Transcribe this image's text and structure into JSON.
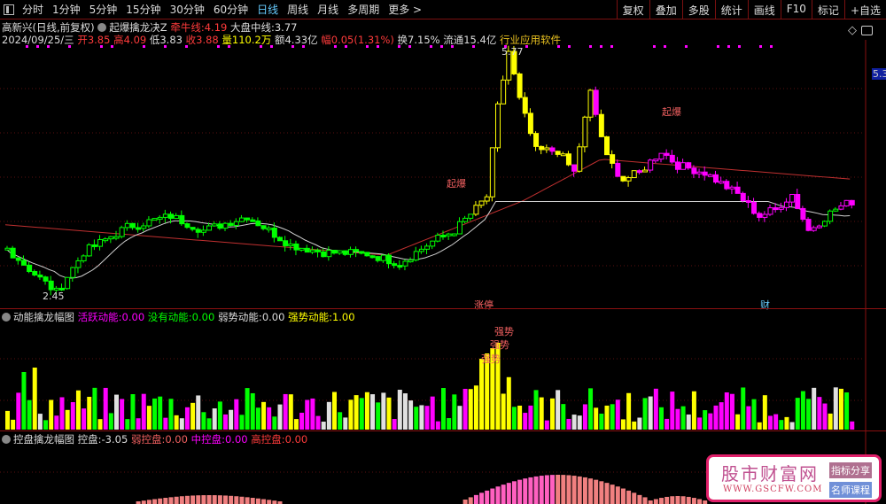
{
  "toolbar": {
    "tabs": [
      "分时",
      "1分钟",
      "5分钟",
      "15分钟",
      "30分钟",
      "60分钟",
      "日线",
      "周线",
      "月线",
      "多周期",
      "更多 >"
    ],
    "active": "日线",
    "right_buttons": [
      "复权",
      "叠加",
      "多股",
      "统计",
      "画线",
      "F10",
      "标记",
      "+自选"
    ]
  },
  "header": {
    "stock": "高新兴(日线,前复权)",
    "indicator": "起爆擒龙决Z",
    "bull_label": "牵牛线:",
    "bull_value": "4.19",
    "market_label": "大盘中线:",
    "market_value": "3.77",
    "date": "2024/09/25/三",
    "open_label": "开",
    "open": "3.85",
    "high_label": "高",
    "high": "4.09",
    "low_label": "低",
    "low": "3.83",
    "close_label": "收",
    "close": "3.88",
    "vol_label": "量",
    "vol": "110.2万",
    "amt_label": "额",
    "amt": "4.33亿",
    "chg_label": "幅",
    "chg": "0.05(1.31%)",
    "turn_label": "换",
    "turn": "7.15%",
    "float_label": "流通",
    "float": "15.4亿",
    "industry": "行业应用软件"
  },
  "main_chart": {
    "high_mark": "5.77",
    "low_mark": "2.45",
    "axis_label": "5.3",
    "signal": "起爆",
    "event_labels": [
      "涨停",
      "财"
    ],
    "price_path": [
      [
        0,
        3.05
      ],
      [
        5,
        2.7
      ],
      [
        9,
        2.45
      ],
      [
        14,
        3.0
      ],
      [
        22,
        3.35
      ],
      [
        30,
        3.5
      ],
      [
        36,
        3.3
      ],
      [
        44,
        3.5
      ],
      [
        52,
        3.1
      ],
      [
        58,
        3.0
      ],
      [
        66,
        2.98
      ],
      [
        72,
        2.85
      ],
      [
        78,
        3.15
      ],
      [
        82,
        3.3
      ],
      [
        86,
        3.6
      ],
      [
        88,
        3.77
      ],
      [
        90,
        5.0
      ],
      [
        92,
        5.77
      ],
      [
        94,
        5.1
      ],
      [
        97,
        4.4
      ],
      [
        101,
        4.4
      ],
      [
        104,
        4.1
      ],
      [
        107,
        5.2
      ],
      [
        110,
        4.3
      ],
      [
        113,
        4.0
      ],
      [
        116,
        4.1
      ],
      [
        120,
        4.4
      ],
      [
        123,
        4.2
      ],
      [
        128,
        4.1
      ],
      [
        134,
        3.8
      ],
      [
        138,
        3.5
      ],
      [
        141,
        3.6
      ],
      [
        144,
        3.8
      ],
      [
        147,
        3.3
      ],
      [
        152,
        3.6
      ],
      [
        155,
        3.7
      ]
    ]
  },
  "energy_panel": {
    "title": "动能擒龙幅图",
    "items": [
      {
        "label": "活跃动能:",
        "value": "0.00"
      },
      {
        "label": "没有动能:",
        "value": "0.00"
      },
      {
        "label": "弱势动能:",
        "value": "0.00"
      },
      {
        "label": "强势动能:",
        "value": "1.00"
      }
    ],
    "signal": "强势"
  },
  "control_panel": {
    "title": "控盘擒龙幅图",
    "items": [
      {
        "label": "控盘:",
        "value": "-3.05"
      },
      {
        "label": "弱控盘:",
        "value": "0.00"
      },
      {
        "label": "中控盘:",
        "value": "0.00"
      },
      {
        "label": "高控盘:",
        "value": "0.00"
      }
    ]
  },
  "watermark": {
    "name": "股市财富网",
    "url": "WWW.GSCFW.COM",
    "badge1": "指标分享",
    "badge2": "名师课程"
  },
  "colors": {
    "green": "#00ff00",
    "yellow": "#ffff00",
    "magenta": "#ff00ff",
    "white": "#e0e0e0",
    "ma": "#c03030"
  }
}
